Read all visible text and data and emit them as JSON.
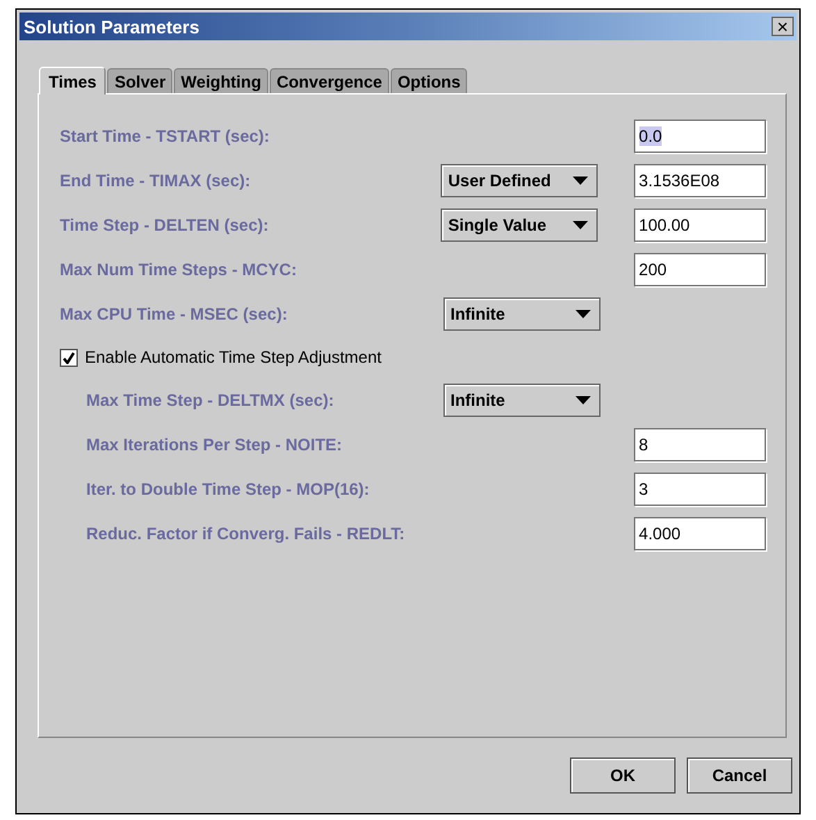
{
  "window": {
    "title": "Solution Parameters",
    "close": "×"
  },
  "tabs": [
    {
      "label": "Times",
      "selected": true
    },
    {
      "label": "Solver",
      "selected": false
    },
    {
      "label": "Weighting",
      "selected": false
    },
    {
      "label": "Convergence",
      "selected": false
    },
    {
      "label": "Options",
      "selected": false
    }
  ],
  "rows": [
    {
      "label": "Start Time - TSTART (sec):",
      "value": "0.0",
      "highlighted": true
    },
    {
      "label": "End Time - TIMAX (sec):",
      "combo": "User Defined",
      "value": "3.1536E08",
      "highlighted": false
    },
    {
      "label": "Time Step - DELTEN (sec):",
      "combo": "Single Value",
      "value": "100.00",
      "highlighted": false
    },
    {
      "label": "Max Num Time Steps - MCYC:",
      "value": "200",
      "highlighted": false
    },
    {
      "label": "Max CPU Time - MSEC (sec):",
      "combo": "Infinite"
    }
  ],
  "auto_adjust": {
    "label": "Enable Automatic Time Step Adjustment",
    "checked": true
  },
  "sub_rows": [
    {
      "label": "Max Time Step - DELTMX (sec):",
      "combo": "Infinite"
    },
    {
      "label": "Max Iterations Per Step - NOITE:",
      "value": "8",
      "highlighted": false
    },
    {
      "label": "Iter. to Double Time Step - MOP(16):",
      "value": "3",
      "highlighted": false
    },
    {
      "label": "Reduc. Factor if Converg. Fails - REDLT:",
      "value": "4.000",
      "highlighted": false
    }
  ],
  "buttons": [
    "OK",
    "Cancel"
  ]
}
